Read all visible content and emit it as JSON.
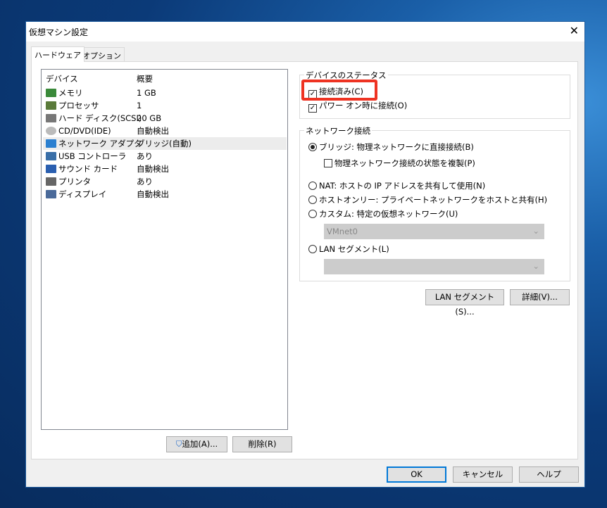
{
  "window": {
    "title": "仮想マシン設定"
  },
  "tabs": [
    {
      "label": "ハードウェア"
    },
    {
      "label": "オプション"
    }
  ],
  "device_list": {
    "headers": {
      "device": "デバイス",
      "summary": "概要"
    },
    "rows": [
      {
        "icon": "memory-icon",
        "device": "メモリ",
        "summary": "1 GB"
      },
      {
        "icon": "processor-icon",
        "device": "プロセッサ",
        "summary": "1"
      },
      {
        "icon": "hard-disk-icon",
        "device": "ハード ディスク(SCSI)",
        "summary": "20 GB"
      },
      {
        "icon": "cd-dvd-icon",
        "device": "CD/DVD(IDE)",
        "summary": "自動検出"
      },
      {
        "icon": "network-adapter-icon",
        "device": "ネットワーク アダプタ",
        "summary": "ブリッジ(自動)"
      },
      {
        "icon": "usb-icon",
        "device": "USB コントローラ",
        "summary": "あり"
      },
      {
        "icon": "sound-icon",
        "device": "サウンド カード",
        "summary": "自動検出"
      },
      {
        "icon": "printer-icon",
        "device": "プリンタ",
        "summary": "あり"
      },
      {
        "icon": "display-icon",
        "device": "ディスプレイ",
        "summary": "自動検出"
      }
    ],
    "add_label": "追加(A)...",
    "remove_label": "削除(R)"
  },
  "device_status": {
    "title": "デバイスのステータス",
    "connected": "接続済み(C)",
    "connect_power_on": "パワー オン時に接続(O)"
  },
  "network": {
    "title": "ネットワーク接続",
    "bridged": "ブリッジ: 物理ネットワークに直接接続(B)",
    "replicate": "物理ネットワーク接続の状態を複製(P)",
    "nat": "NAT: ホストの IP アドレスを共有して使用(N)",
    "host_only": "ホストオンリー: プライベートネットワークをホストと共有(H)",
    "custom": "カスタム: 特定の仮想ネットワーク(U)",
    "custom_value": "VMnet0",
    "lan_segment": "LAN セグメント(L)",
    "lan_segment_value": ""
  },
  "buttons": {
    "lan_segments": "LAN セグメント(S)...",
    "advanced": "詳細(V)...",
    "ok": "OK",
    "cancel": "キャンセル",
    "help": "ヘルプ"
  },
  "highlight_color": "#ee3322"
}
